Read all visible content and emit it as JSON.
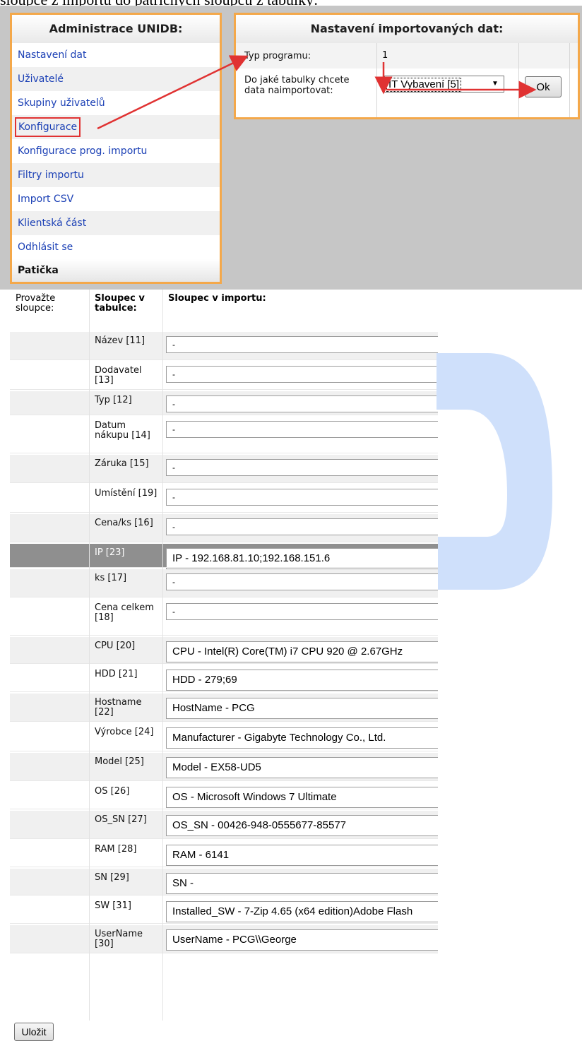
{
  "caption": "sloupce z importu do patřičných sloupců z tabulky:",
  "admin": {
    "title": "Administrace UNIDB:",
    "items": [
      "Nastavení dat",
      "Uživatelé",
      "Skupiny uživatelů",
      "Konfigurace",
      "Konfigurace prog. importu",
      "Filtry importu",
      "Import CSV",
      "Klientská část",
      "Odhlásit se"
    ],
    "footer": "Patička"
  },
  "import_settings": {
    "title": "Nastavení importovaných dat:",
    "program_label": "Typ programu:",
    "program_value": "1",
    "table_label": "Do jaké tabulky chcete data naimportovat:",
    "table_select": "IT Vybavení [5]",
    "ok_label": "Ok"
  },
  "mapping": {
    "h1": "Provažte sloupce:",
    "h2": "Sloupec v tabulce:",
    "h3": "Sloupec v importu:",
    "rows": [
      {
        "col": "Název [11]",
        "value": "-"
      },
      {
        "col": "Dodavatel [13]",
        "value": "-"
      },
      {
        "col": "Typ [12]",
        "value": "-"
      },
      {
        "col": "Datum nákupu [14]",
        "value": "-"
      },
      {
        "col": "Záruka [15]",
        "value": "-"
      },
      {
        "col": "Umístění [19]",
        "value": "-"
      },
      {
        "col": "Cena/ks [16]",
        "value": "-"
      },
      {
        "col": "IP [23]",
        "value": "IP - 192.168.81.10;192.168.151.6"
      },
      {
        "col": "ks [17]",
        "value": "-"
      },
      {
        "col": "Cena celkem [18]",
        "value": "-"
      },
      {
        "col": "CPU [20]",
        "value": "CPU - Intel(R) Core(TM) i7 CPU 920 @ 2.67GHz"
      },
      {
        "col": "HDD [21]",
        "value": "HDD - 279;69"
      },
      {
        "col": "Hostname [22]",
        "value": "HostName - PCG"
      },
      {
        "col": "Výrobce [24]",
        "value": "Manufacturer - Gigabyte Technology Co., Ltd."
      },
      {
        "col": "Model [25]",
        "value": "Model - EX58-UD5"
      },
      {
        "col": "OS [26]",
        "value": "OS - Microsoft Windows 7 Ultimate"
      },
      {
        "col": "OS_SN [27]",
        "value": "OS_SN - 00426-948-0555677-85577"
      },
      {
        "col": "RAM [28]",
        "value": "RAM - 6141"
      },
      {
        "col": "SN [29]",
        "value": "SN -"
      },
      {
        "col": "SW [31]",
        "value": "Installed_SW - 7-Zip 4.65 (x64 edition)Adobe Flash"
      },
      {
        "col": "UserName [30]",
        "value": "UserName - PCG\\\\George"
      }
    ]
  },
  "save_label": "Uložit",
  "colors": {
    "panel_border": "#f4a84a",
    "link": "#1a3fb5",
    "annotation_red": "#e03232",
    "highlight_row": "#8f8f8f",
    "watermark_blue": "#cfe0fb"
  }
}
